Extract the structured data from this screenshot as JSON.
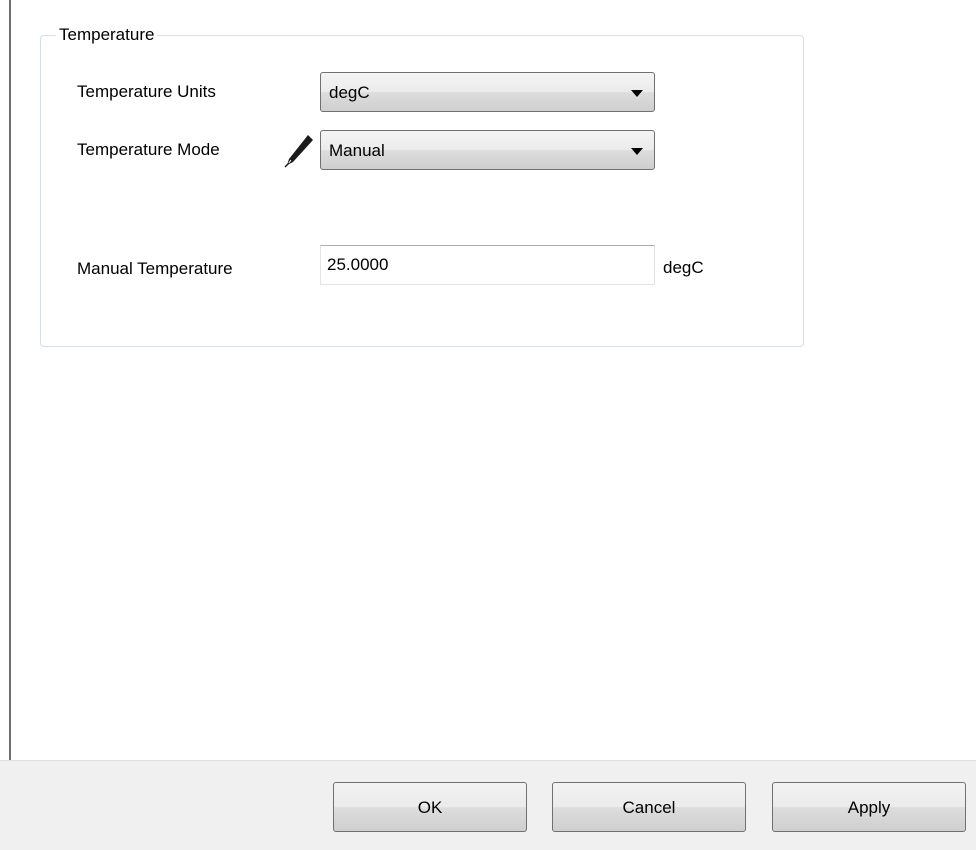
{
  "group": {
    "title": "Temperature"
  },
  "fields": {
    "units_label": "Temperature Units",
    "units_value": "degC",
    "mode_label": "Temperature Mode",
    "mode_value": "Manual",
    "manual_label": "Manual Temperature",
    "manual_value": "25.0000",
    "manual_unit": "degC"
  },
  "icons": {
    "mode_indicator": "pencil-icon"
  },
  "buttons": {
    "ok": "OK",
    "cancel": "Cancel",
    "apply": "Apply"
  },
  "colors": {
    "group_border": "#d5dfe5",
    "button_bar_bg": "#f0f0f0"
  }
}
